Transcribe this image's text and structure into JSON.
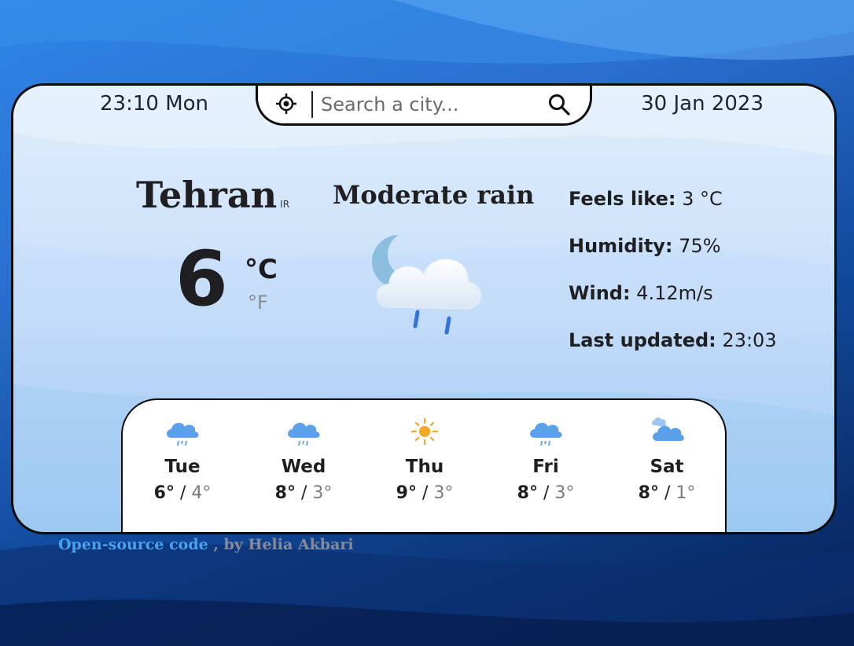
{
  "header": {
    "time": "23:10 Mon",
    "date": "30 Jan 2023"
  },
  "search": {
    "placeholder": "Search a city...",
    "locate_icon": "crosshair-icon",
    "search_icon": "magnifier-icon"
  },
  "current": {
    "city": "Tehran",
    "country": "IR",
    "temperature": "6",
    "unit_c": "°C",
    "unit_f": "°F",
    "condition": "Moderate rain",
    "icon": "moon-cloud-rain-icon"
  },
  "details": {
    "feels_like_label": "Feels like:",
    "feels_like_value": "3 °C",
    "humidity_label": "Humidity:",
    "humidity_value": "75%",
    "wind_label": "Wind:",
    "wind_value": "4.12m/s",
    "updated_label": "Last updated:",
    "updated_value": "23:03"
  },
  "forecast": [
    {
      "day": "Tue",
      "high": "6°",
      "sep": " / ",
      "low": "4°",
      "icon": "rain-cloud-icon"
    },
    {
      "day": "Wed",
      "high": "8°",
      "sep": " / ",
      "low": "3°",
      "icon": "rain-cloud-icon"
    },
    {
      "day": "Thu",
      "high": "9°",
      "sep": " / ",
      "low": "3°",
      "icon": "sun-icon"
    },
    {
      "day": "Fri",
      "high": "8°",
      "sep": " / ",
      "low": "3°",
      "icon": "rain-cloud-icon"
    },
    {
      "day": "Sat",
      "high": "8°",
      "sep": " / ",
      "low": "1°",
      "icon": "cloudy-icon"
    }
  ],
  "footer": {
    "link_text": "Open-source code",
    "credit": " , by Helia Akbari"
  },
  "colors": {
    "accent": "#4aa3f0",
    "rain": "#3b82e0",
    "sun": "#f5a623"
  }
}
